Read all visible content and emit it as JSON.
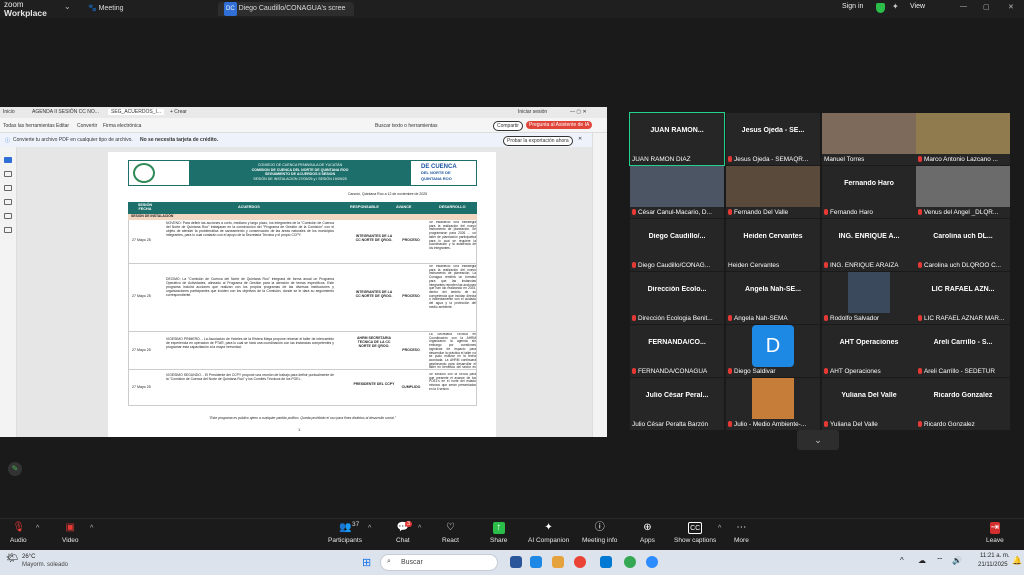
{
  "topbar": {
    "brand_top": "zoom",
    "brand_bottom": "Workplace",
    "meeting_tab": "Meeting",
    "share_tab": "Diego Caudillo/CONAGUA's scree",
    "sign_in": "Sign in",
    "view": "View"
  },
  "pdf": {
    "tabs": [
      "Inicio",
      "AGENDA II SESIÓN  CC NO...",
      "SEG_ACUERDOS_I...",
      "+ Crear"
    ],
    "signin": "Iniciar sesión",
    "menu": [
      "Todas las herramientas",
      "Editar",
      "Convertir",
      "Firma electrónica"
    ],
    "search_tools": "Buscar texto o herramientas",
    "share_btn": "Compartir",
    "ai_btn": "Pregunta al Asistente de IA",
    "info_text": "Convierte tu archivo PDF en cualquier tipo de archivo.",
    "info_bold": "No se necesita tarjeta de crédito.",
    "export_btn": "Probar la exportación ahora",
    "header_lines": [
      "CONSEJO DE CUENCA PENINSULA DE YUCATÁN",
      "COMISION DE CUENCA DEL NORTE DE QUINTANA ROO",
      "SEGUIMIENTO DE ACUERDOS II SESION",
      "SESIÓN DE INSTALACION 27/05/25 y I SESIÓN 19/09/25"
    ],
    "right_logo": [
      "DE CUENCA",
      "DEL NORTE DE",
      "QUINTANA ROO"
    ],
    "place_date": "Cancún, Quintana Roo a 12 de noviembre de 2025",
    "columns": [
      "SESIÓN FECHA",
      "ACUERDOS",
      "RESPONSABLE",
      "AVANCE",
      "DESARROLLO"
    ],
    "section": "SESIÓN DE INSTALACIÓN",
    "rows": [
      {
        "date": "27 Mayo 25",
        "acuerdo": "NOVENO: Para definir las acciones a corto, mediano y largo plazo, los integrantes de la \"Comisión de Cuenca del Norte de Quintana Roo\" trabajaran en la construcción del \"Programa de Gestión de la Comisión\" con el objeto de atender la problemática de saneamiento y conservación de las áreas naturales de los municipios integrantes, para lo cual contarán con el apoyo de la Secretaria Técnica y el propio CCPY.",
        "resp": "INTEGRANTES DE LA CC NORTE DE QROO.",
        "avance": "PROCESO",
        "desarrollo": "Se estableció una estrategia para la realización del nuevo instrumento de planeación. Se programaron para 2026 ... un taller de planeación participativa para lo cual se requiere la coordinación y la asistencia de los integrantes."
      },
      {
        "date": "27 Mayo 25",
        "acuerdo": "DECIMO: La \"Comisión de Cuenca del Norte de Quintana Roo\" integrará de forma anual un Programa Operativo de Actividades, alineado al Programa de Gestión para la atención de temas específicos. Este programa incluirá acciones que realizan con los propios programas de las diversas instituciones y organizaciones participantes que inciden con los objetivos de la Comisión, donde se le dará su seguimiento correspondiente.",
        "resp": "INTEGRANTES DE LA CC NORTE DE QROO.",
        "avance": "PROCESO",
        "desarrollo": "Se estableció una estrategia para la realización del nuevo instrumento de planeación. La Conagua remitirá un formato para que las instancias integrantes reporten las acciones que han ido realizando en 2025, dentro del ámbito de su competencia que incidan directa o indirectamente con el cuidado del agua y la protección del medio ambiente."
      },
      {
        "date": "27 Mayo 25",
        "acuerdo": "VIGESIMO PRIMERO. - La Asociación de Hoteles de la Riviera Maya propone retomar el taller de intercambio de experiencia en operación de PTAR, para lo cual se hará una coordinación con las instancias competentes y programar esta capacitación a la mayor brevedad.",
        "resp": "AHRM SECRETARIA TECNICA DE LA CC NORTE DE QROO.",
        "avance": "PROCESO",
        "desarrollo": "La Secretaría Técnica en Coordinación con la AHRM organizaron la agenda sin embargo por cuestiones logísticas de espacio para desarrollar la práctica el taller no se pudo realizar en la fecha acordada. La AHRM continuará gestionando para desarrollar el taller en beneficio del sector en fecha por definir."
      },
      {
        "date": "27 Mayo 25",
        "acuerdo": "VIGESIMO SEGUNDO. - El Presidente del CCPY propone una reunión de trabajo para definir puntualmente de la \"Comisión de Cuenca del Norte de Quintana Roo\" y los Comités Técnicos de los POEL.",
        "resp": "PRESIDENTE DEL CCPY",
        "avance": "CUMPLIDO",
        "desarrollo": "Se sostuvo con la SEMA para que presente el avance de los POEL's en el norte del estado mismos que serán presentados en la II sesión."
      }
    ],
    "footer": "\"Este programa es público ajeno a cualquier partido político. Queda prohibido el uso para fines distintos al desarrollo social.\"",
    "page_number": "1"
  },
  "gallery": [
    {
      "name": "JUAN RAMON...",
      "label": "JUAN RAMON DIAZ",
      "muted": false,
      "active": true
    },
    {
      "name": "Jesus Ojeda - SE...",
      "label": "Jesus Ojeda - SEMAQR...",
      "muted": true
    },
    {
      "name": "",
      "label": "Manuel Torres",
      "muted": false,
      "photo": "#7d6a5a"
    },
    {
      "name": "",
      "label": "Marco Antonio Lazcano ...",
      "muted": true,
      "photo": "#8f7b4d"
    },
    {
      "name": "",
      "label": "César Canul-Macario, D...",
      "muted": true,
      "photo": "#4b5563"
    },
    {
      "name": "",
      "label": "Fernando Del Valle",
      "muted": true,
      "photo": "#5a4a3b"
    },
    {
      "name": "Fernando Haro",
      "label": "Fernando Haro",
      "muted": true
    },
    {
      "name": "",
      "label": "Venus del Angel _DLQR...",
      "muted": true,
      "photo": "#6b6b6b"
    },
    {
      "name": "Diego Caudillo/...",
      "label": "Diego Caudillo/CONAG...",
      "muted": true
    },
    {
      "name": "Heiden Cervantes",
      "label": "Heiden Cervantes",
      "muted": false
    },
    {
      "name": "ING. ENRIQUE A...",
      "label": "ING. ENRIQUE ARAIZA",
      "muted": true
    },
    {
      "name": "Carolina uch DL...",
      "label": "Carolina uch DLQROO C...",
      "muted": true
    },
    {
      "name": "Dirección Ecolo...",
      "label": "Dirección Ecologia Benit...",
      "muted": true
    },
    {
      "name": "Angela Nah-SE...",
      "label": "Angela Nah-SEMA",
      "muted": true
    },
    {
      "name": "",
      "label": "Rodolfo Salvador",
      "muted": true,
      "small": "#3a4a5c"
    },
    {
      "name": "LIC RAFAEL AZN...",
      "label": "LIC RAFAEL AZNAR MAR...",
      "muted": true
    },
    {
      "name": "FERNANDA/CO...",
      "label": "FERNANDA/CONAGUA",
      "muted": true
    },
    {
      "name": "",
      "label": "Diego Saldivar",
      "muted": true,
      "letter": "D"
    },
    {
      "name": "AHT Operaciones",
      "label": "AHT Operaciones",
      "muted": true
    },
    {
      "name": "Areli Carrillo - S...",
      "label": "Areli Carrillo - SEDETUR",
      "muted": true
    },
    {
      "name": "Julio César Peral...",
      "label": "Julio César Peralta Barzón",
      "muted": false
    },
    {
      "name": "",
      "label": "Julio - Medio Ambiente-...",
      "muted": true,
      "small": "#c77d3a"
    },
    {
      "name": "Yuliana Del Valle",
      "label": "Yuliana Del Valle",
      "muted": true
    },
    {
      "name": "Ricardo Gonzalez",
      "label": "Ricardo Gonzalez",
      "muted": true
    }
  ],
  "toolbar": {
    "audio": "Audio",
    "video": "Video",
    "participants": "Participants",
    "participants_count": "37",
    "chat": "Chat",
    "chat_badge": "3",
    "react": "React",
    "share": "Share",
    "ai": "AI Companion",
    "info": "Meeting info",
    "apps": "Apps",
    "captions": "Show captions",
    "more": "More",
    "leave": "Leave"
  },
  "taskbar": {
    "temp": "26°C",
    "weather": "Mayorm. soleado",
    "search": "Buscar",
    "time": "11:21 a. m.",
    "date": "21/11/2025"
  }
}
